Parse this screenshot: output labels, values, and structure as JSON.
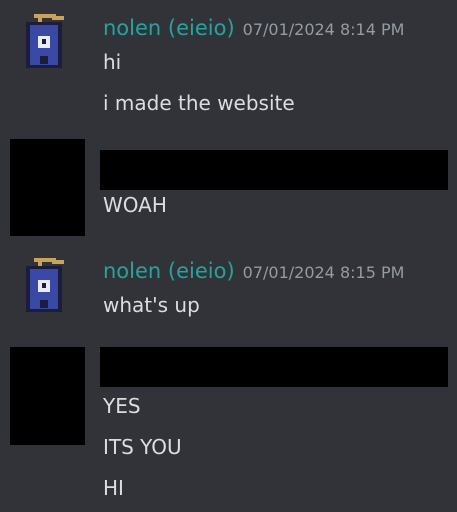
{
  "colors": {
    "background": "#313338",
    "username": "#23a59d",
    "timestamp": "#949ba4",
    "message_text": "#dbdee1",
    "redaction": "#000000"
  },
  "messages": [
    {
      "author": "nolen (eieio)",
      "timestamp": "07/01/2024 8:14 PM",
      "avatar_icon": "mailbox-pixel-avatar-icon",
      "lines": [
        "hi",
        "i made the website"
      ]
    },
    {
      "author_redacted": true,
      "lines": [
        "WOAH"
      ]
    },
    {
      "author": "nolen (eieio)",
      "timestamp": "07/01/2024 8:15 PM",
      "avatar_icon": "mailbox-pixel-avatar-icon",
      "lines": [
        "what's up"
      ]
    },
    {
      "author_redacted": true,
      "lines": [
        "YES",
        "ITS YOU",
        "HI"
      ]
    }
  ]
}
